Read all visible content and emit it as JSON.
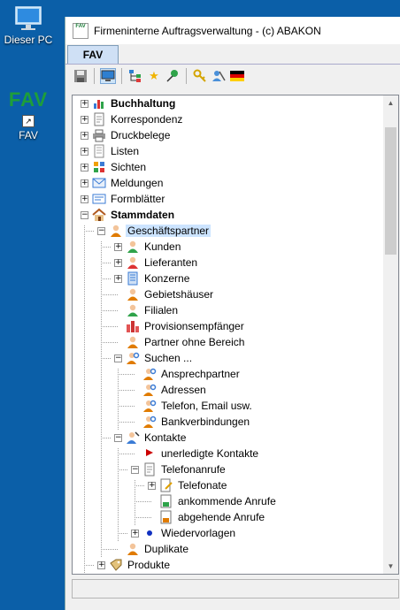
{
  "desktop": {
    "icons": [
      {
        "label": "Dieser PC",
        "icon": "monitor-icon"
      },
      {
        "label": "FAV",
        "logo_text": "FAV",
        "icon": "fav-logo"
      }
    ]
  },
  "window": {
    "app_icon_text": "FAV",
    "title": "Firmeninterne Auftragsverwaltung - (c) ABAKON",
    "tab": "FAV",
    "toolbar": [
      "save-icon",
      "monitor-icon",
      "tree-icon",
      "star-icon",
      "pin-icon",
      "key-icon",
      "users-icon",
      "flag-icon"
    ]
  },
  "tree": {
    "items": [
      {
        "label": "Buchhaltung",
        "bold": true
      },
      {
        "label": "Korrespondenz"
      },
      {
        "label": "Druckbelege"
      },
      {
        "label": "Listen"
      },
      {
        "label": "Sichten"
      },
      {
        "label": "Meldungen"
      },
      {
        "label": "Formblätter"
      },
      {
        "label": "Stammdaten",
        "bold": true
      },
      {
        "label": "Geschäftspartner",
        "selected": true
      },
      {
        "label": "Kunden"
      },
      {
        "label": "Lieferanten"
      },
      {
        "label": "Konzerne"
      },
      {
        "label": "Gebietshäuser"
      },
      {
        "label": "Filialen"
      },
      {
        "label": "Provisionsempfänger"
      },
      {
        "label": "Partner ohne Bereich"
      },
      {
        "label": "Suchen ..."
      },
      {
        "label": "Ansprechpartner"
      },
      {
        "label": "Adressen"
      },
      {
        "label": "Telefon, Email usw."
      },
      {
        "label": "Bankverbindungen"
      },
      {
        "label": "Kontakte"
      },
      {
        "label": "unerledigte Kontakte"
      },
      {
        "label": "Telefonanrufe"
      },
      {
        "label": "Telefonate"
      },
      {
        "label": "ankommende Anrufe"
      },
      {
        "label": "abgehende Anrufe"
      },
      {
        "label": "Wiedervorlagen"
      },
      {
        "label": "Duplikate"
      },
      {
        "label": "Produkte"
      }
    ]
  },
  "colors": {
    "desktop": "#0b5fa8",
    "selection": "#cce4ff",
    "fav_green": "#1e9e3a"
  }
}
